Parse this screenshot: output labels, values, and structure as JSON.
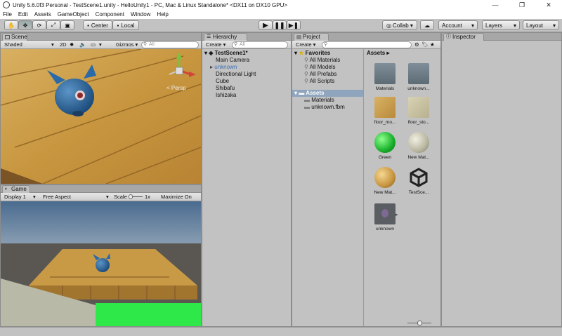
{
  "window": {
    "title": "Unity 5.6.0f3 Personal - TestScene1.unity - HelloUnity1 - PC, Mac & Linux Standalone* <DX11 on DX10 GPU>",
    "buttons": [
      "—",
      "❐",
      "✕"
    ]
  },
  "menu": [
    "File",
    "Edit",
    "Assets",
    "GameObject",
    "Component",
    "Window",
    "Help"
  ],
  "toolbar": {
    "center_label": "Center",
    "local_label": "Local",
    "collab_label": "Collab ▾",
    "account_label": "Account",
    "layers_label": "Layers",
    "layout_label": "Layout"
  },
  "scene": {
    "tab_label": "Scene",
    "shading": "Shaded",
    "mode_2d": "2D",
    "gizmos": "Gizmos ▾",
    "search_placeholder": "All",
    "persp_label": "< Persp"
  },
  "game": {
    "tab_label": "Game",
    "display": "Display 1",
    "aspect": "Free Aspect",
    "scale_label": "Scale",
    "scale_value": "1x",
    "maximize": "Maximize On Play"
  },
  "hierarchy": {
    "tab_label": "Hierarchy",
    "create": "Create ▾",
    "search_placeholder": "All",
    "scene_name": "TestScene1*",
    "items": [
      "Main Camera",
      "unknown",
      "Directional Light",
      "Cube",
      "Shibafu",
      "Ishizaka"
    ]
  },
  "project": {
    "tab_label": "Project",
    "create": "Create ▾",
    "favorites_label": "Favorites",
    "favorites": [
      "All Materials",
      "All Models",
      "All Prefabs",
      "All Scripts"
    ],
    "assets_label": "Assets",
    "asset_folders": [
      "Materials",
      "unknown.fbm"
    ],
    "breadcrumb": "Assets ▸",
    "assets": [
      "Materials",
      "unknown...",
      "floor_mo...",
      "floor_sto...",
      "Green",
      "New Mat...",
      "New Mat...",
      "TestSce...",
      "unknown"
    ]
  },
  "inspector": {
    "tab_label": "Inspector"
  },
  "colors": {
    "accent": "#3d6fb0",
    "panel": "#c2c2c2",
    "selection": "#8fa5bd"
  }
}
